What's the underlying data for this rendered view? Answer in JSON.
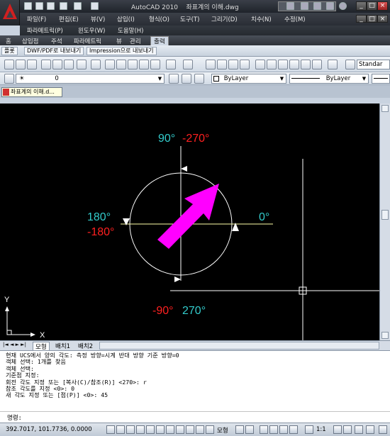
{
  "app": {
    "title": "AutoCAD 2010",
    "filename": "좌표계의 이해.dwg"
  },
  "menus": {
    "row1": [
      "파일(F)",
      "편집(E)",
      "뷰(V)",
      "삽입(I)",
      "형식(O)",
      "도구(T)",
      "그리기(D)",
      "치수(N)",
      "수정(M)"
    ],
    "row2": [
      "파라메트릭(P)",
      "윈도우(W)",
      "도움말(H)"
    ]
  },
  "ribbon": {
    "tabs": [
      "홈",
      "삽입점",
      "주석",
      "파라메트릭",
      "뷰",
      "관리",
      "출력"
    ],
    "active_tab": "출력",
    "panel_items": [
      "플롯",
      "DWF/PDF로 내보내기",
      "Impression으로 내보내기"
    ]
  },
  "toolbar": {
    "layer_value": "0",
    "color_value": "ByLayer",
    "linetype_value": "ByLayer",
    "style_value": "Standar"
  },
  "document_tab": {
    "label": "좌표계의 이해.d..."
  },
  "drawing": {
    "labels": {
      "top_cyan": "90°",
      "top_red": "-270°",
      "left_cyan": "180°",
      "left_red": "-180°",
      "right_cyan": "0°",
      "bottom_red": "-90°",
      "bottom_cyan": "270°"
    },
    "ucs": {
      "y": "Y",
      "x": "X"
    },
    "colors": {
      "cyan": "#33cccc",
      "red": "#ff2020",
      "magenta": "#ff00ff",
      "background": "#000000"
    }
  },
  "layout_tabs": [
    "모형",
    "배치1",
    "배치2"
  ],
  "command_history": [
    "현재 UCS에서 양의 각도:  측정 방향=시계 반대 방향 기준 방향=0",
    "객체 선택: 1개를 찾음",
    "객체 선택:",
    "기준점 지정:",
    "회전 각도 지정 또는 [복사(C)/참조(R)] <270>: r",
    "참조 각도를 지정 <0>: 0",
    "새 각도 지정 또는 [점(P)] <0>: 45"
  ],
  "command_prompt": "명령:",
  "status": {
    "coordinates": "392.7017, 101.7736, 0.0000",
    "model_label": "모형",
    "scale_label": "1:1"
  }
}
